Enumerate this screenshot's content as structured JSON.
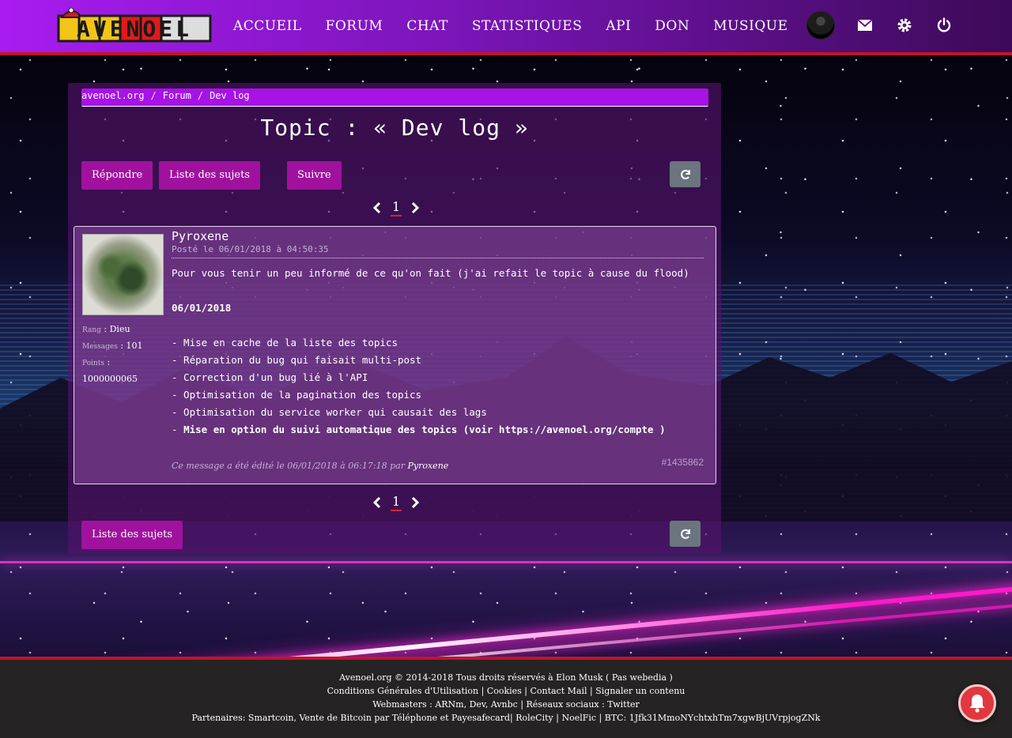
{
  "header": {
    "logo_text": "AVENOEL",
    "nav": [
      "ACCUEIL",
      "FORUM",
      "CHAT",
      "STATISTIQUES",
      "API",
      "DON",
      "MUSIQUE"
    ],
    "icons": [
      "avatar",
      "envelope-icon",
      "gear-icon",
      "power-icon"
    ]
  },
  "breadcrumb": {
    "items": [
      "avenoel.org",
      "Forum",
      "Dev log"
    ],
    "separator": "/"
  },
  "topic": {
    "title": "Topic : « Dev log »"
  },
  "buttons": {
    "reply": "Répondre",
    "subjects": "Liste des sujets",
    "follow": "Suivre",
    "subjects_bottom": "Liste des sujets"
  },
  "pagination": {
    "current": "1"
  },
  "post": {
    "author": "Pyroxene",
    "date": "Posté le 06/01/2018 à 04:50:35",
    "rank_label": "Rang",
    "rank_value": ": Dieu",
    "messages_label": "Messages",
    "messages_value": ": 101",
    "points_label": "Points",
    "points_value": ":",
    "points_number": "1000000065",
    "intro": "Pour vous tenir un peu informé de ce qu'on fait (j'ai refait le topic à cause du flood)",
    "date_heading": "06/01/2018",
    "items": [
      "- Mise en cache de la liste des topics",
      "- Réparation du bug qui faisait multi-post",
      "- Correction d'un bug lié à l'API",
      "- Optimisation de la pagination des topics",
      "- Optimisation du service worker qui causait des lags"
    ],
    "last_item_prefix": "- ",
    "last_item_bold": "Mise en option du suivi automatique des topics (voir https://avenoel.org/compte )",
    "id": "#1435862",
    "edited_text": "Ce message a été édité le 06/01/2018 à 06:17:18 par",
    "edited_by": "Pyroxene"
  },
  "footer": {
    "line1": "Avenoel.org © 2014-2018 Tous droits réservés à Elon Musk ( Pas webedia )",
    "line2": "Conditions Générales d'Utilisation | Cookies | Contact Mail | Signaler un contenu",
    "line3": "Webmasters : ARNm, Dev, Avnbc | Réseaux sociaux : Twitter",
    "line4": "Partenaires: Smartcoin, Vente de Bitcoin par Téléphone et Payesafecard| RoleCity | NoelFic | BTC: 1Jfk31MmoNYchtxhTm7xgwBjUVrpjogZNk"
  },
  "colors": {
    "header_start": "#a81cf0",
    "header_end": "#3c0a58",
    "accent_red": "#c0142c",
    "button": "#a0129e",
    "breadcrumb": "#a812e6",
    "refresh_button": "#6c757d",
    "notification": "#e0383e"
  }
}
